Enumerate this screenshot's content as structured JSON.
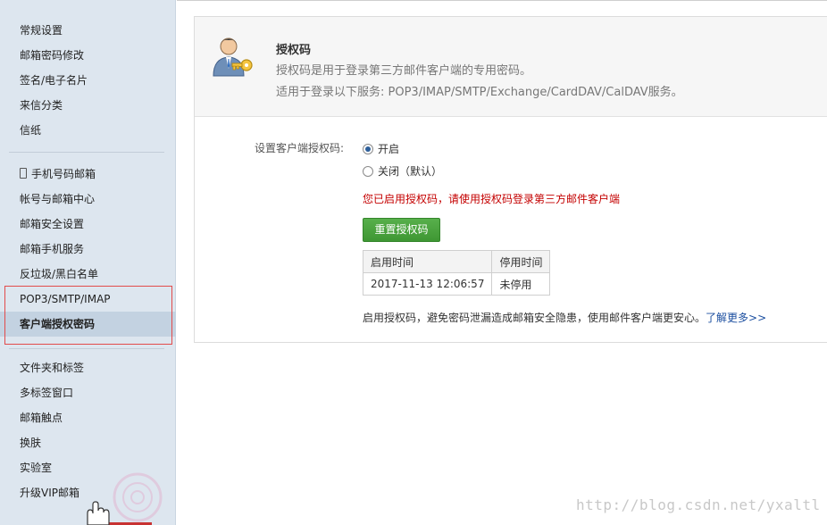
{
  "sidebar": {
    "group1": [
      "常规设置",
      "邮箱密码修改",
      "签名/电子名片",
      "来信分类",
      "信纸"
    ],
    "group2": [
      "手机号码邮箱",
      "帐号与邮箱中心",
      "邮箱安全设置",
      "邮箱手机服务",
      "反垃圾/黑白名单",
      "POP3/SMTP/IMAP",
      "客户端授权密码"
    ],
    "group3": [
      "文件夹和标签",
      "多标签窗口",
      "邮箱触点",
      "换肤",
      "实验室",
      "升级VIP邮箱"
    ],
    "active_item": "客户端授权密码"
  },
  "header": {
    "title": "授权码",
    "line1": "授权码是用于登录第三方邮件客户端的专用密码。",
    "line2": "适用于登录以下服务: POP3/IMAP/SMTP/Exchange/CardDAV/CalDAV服务。"
  },
  "settings": {
    "label": "设置客户端授权码:",
    "option_on": "开启",
    "option_off": "关闭（默认）",
    "selected": "开启",
    "status_message": "您已启用授权码，请使用授权码登录第三方邮件客户端",
    "reset_button": "重置授权码"
  },
  "auth_table": {
    "headers": [
      "启用时间",
      "停用时间"
    ],
    "rows": [
      [
        "2017-11-13 12:06:57",
        "未停用"
      ]
    ]
  },
  "footer": {
    "note": "启用授权码，避免密码泄漏造成邮箱安全隐患，使用邮件客户端更安心。",
    "link": "了解更多>>"
  },
  "watermark": "http://blog.csdn.net/yxaltl",
  "colors": {
    "sidebar_bg": "#dde6ef",
    "active_bg": "#c3d2e1",
    "highlight_border": "#e24b4b",
    "status_red": "#c40000",
    "button_green": "#4aa63e",
    "link_blue": "#1c4fa0"
  },
  "icons": [
    "user-key-icon",
    "phone-icon",
    "hand-cursor-icon"
  ]
}
